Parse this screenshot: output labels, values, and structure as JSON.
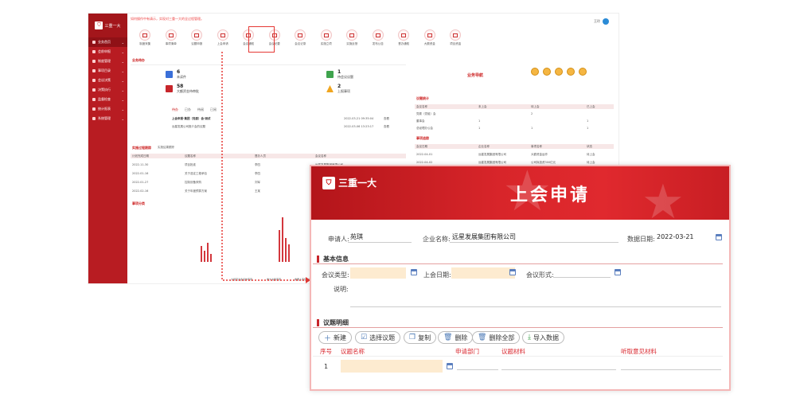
{
  "dashboard": {
    "brand": "三重一大",
    "notice": "如何操作中有请示，实现对三重一大的全过程管理。",
    "user_name": "王玲",
    "sidebar": [
      {
        "label": "业务首页"
      },
      {
        "label": "会前申报"
      },
      {
        "label": "制度管理"
      },
      {
        "label": "事项目录"
      },
      {
        "label": "会议决策"
      },
      {
        "label": "决策执行"
      },
      {
        "label": "监督检查"
      },
      {
        "label": "统计报表"
      },
      {
        "label": "系统管理"
      }
    ],
    "tools": [
      {
        "label": "制度采集"
      },
      {
        "label": "事项清单"
      },
      {
        "label": "议题申报"
      },
      {
        "label": "上会申请"
      },
      {
        "label": "会议通知"
      },
      {
        "label": "会议纪要"
      },
      {
        "label": "会议记录"
      },
      {
        "label": "实施立项"
      },
      {
        "label": "实施反馈"
      },
      {
        "label": "发布公告"
      },
      {
        "label": "督办通知"
      },
      {
        "label": "大额资金"
      },
      {
        "label": "项目资金"
      }
    ],
    "section_todo": "业务待办",
    "stats": [
      {
        "num": "6",
        "label": "未读件"
      },
      {
        "num": "58",
        "label": "大额资金待审批"
      },
      {
        "num": "1",
        "label": "待会议议题"
      },
      {
        "num": "2",
        "label": "上报事项"
      }
    ],
    "tabs": [
      "待办",
      "已办",
      "待阅",
      "已阅"
    ],
    "todo_rows": [
      {
        "title": "上会申报-集团（党委）会-测试",
        "date": "2022-03-21 09:35:04",
        "action": "查看"
      },
      {
        "title": "远星发展公司推介会的议题",
        "date": "2022-03-06 13:23:17",
        "action": "查看"
      }
    ],
    "section_impl": "实施过程跟踪",
    "impl_tab2": "实施结果跟踪",
    "impl_head": [
      "计划完成日期",
      "议题名称",
      "督办人员",
      "会议名称"
    ],
    "impl_rows": [
      {
        "date": "2022-11-30",
        "name": "项目批准",
        "person": "李四",
        "meeting": "远星发展集团有限公司"
      },
      {
        "date": "2022-01-16",
        "name": "关于选定工程承包",
        "person": "李四",
        "meeting": "远星发展集团有限公司"
      },
      {
        "date": "2022-01-27",
        "name": "控制设备采购",
        "person": "刘军",
        "meeting": "远星发展集团有限公司"
      },
      {
        "date": "2022-02-16",
        "name": "关于年度预算方案",
        "person": "王某",
        "meeting": "远星发展集团有限公司"
      }
    ],
    "section_chart": "事项分类",
    "chart_legend": [
      "大额度资金运作事项",
      "重大决策事项",
      "重要人事任免事项",
      "重要项目安排事项"
    ],
    "right_title": "业务导航",
    "sec_meeting": "议题统计",
    "meeting_head": [
      "会议名称",
      "未上会",
      "待上会",
      "已上会"
    ],
    "meeting_rows": [
      {
        "name": "党委（党组）会",
        "a": "",
        "b": "2",
        "c": ""
      },
      {
        "name": "董事会",
        "a": "1",
        "b": "1",
        "c": ""
      },
      {
        "name": "总经理办公会",
        "a": "1",
        "b": "1",
        "c": "1"
      }
    ],
    "sec_record": "事项追踪",
    "record_head": [
      "会议日期",
      "企业名称",
      "事项名称",
      "状态"
    ],
    "record_rows": [
      {
        "date": "2022-04-01",
        "org": "远星发展集团有限公司",
        "item": "大额资金运作",
        "status": "待上会"
      },
      {
        "date": "2022-04-02",
        "org": "远星发展集团有限公司",
        "item": "公司拟投资300亿元",
        "status": "待上会"
      },
      {
        "date": "2022-04-03",
        "org": "远星发展集团有限公司",
        "item": "集团投资重要项目",
        "status": "待上会"
      }
    ]
  },
  "form": {
    "brand": "三重一大",
    "title": "上会申请",
    "applicant_label": "申请人:",
    "applicant_value": "苑琪",
    "company_label": "企业名称:",
    "company_value": "远星发展集团有限公司",
    "date_label": "数据日期:",
    "date_value": "2022-03-21",
    "section_basic": "基本信息",
    "meeting_type_label": "会议类型:",
    "meeting_date_label": "上会日期:",
    "meeting_form_label": "会议形式:",
    "note_label": "说明:",
    "section_topics": "议题明细",
    "buttons": [
      {
        "label": "新建",
        "icon": "plus-icon"
      },
      {
        "label": "选择议题",
        "icon": "select-icon"
      },
      {
        "label": "复制",
        "icon": "copy-icon"
      },
      {
        "label": "删除",
        "icon": "delete-icon"
      },
      {
        "label": "删除全部",
        "icon": "delete-all-icon"
      },
      {
        "label": "导入数据",
        "icon": "import-icon"
      }
    ],
    "table_head": [
      "序号",
      "议题名称",
      "申请部门",
      "议题材料",
      "听取意见材料"
    ],
    "first_row_index": "1"
  },
  "colors": {
    "brand_red": "#c7262b",
    "highlight": "#e53935",
    "input_fill": "#fdebd0"
  }
}
